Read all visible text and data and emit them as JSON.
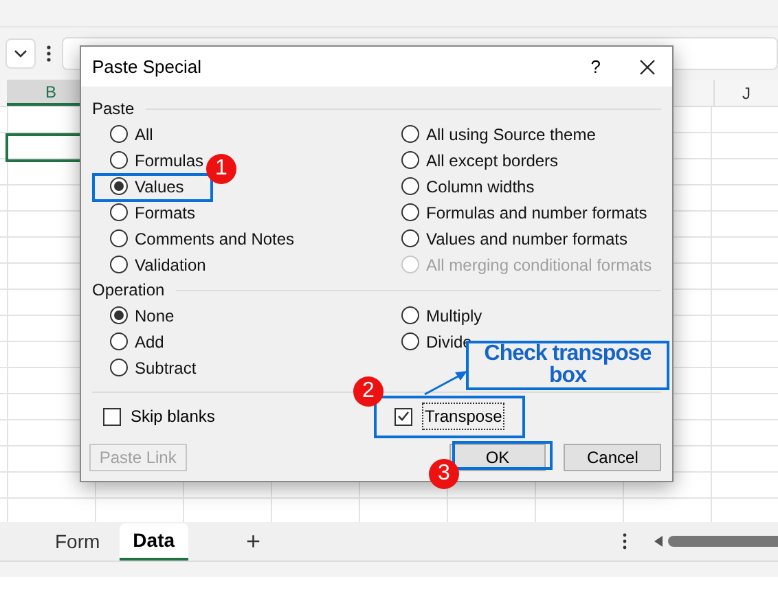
{
  "columns": [
    "B",
    "J"
  ],
  "dialog": {
    "title": "Paste Special",
    "help": "?",
    "paste": {
      "label": "Paste",
      "left_options": [
        {
          "label": "All",
          "selected": false,
          "disabled": false
        },
        {
          "label": "Formulas",
          "selected": false,
          "disabled": false
        },
        {
          "label": "Values",
          "selected": true,
          "disabled": false
        },
        {
          "label": "Formats",
          "selected": false,
          "disabled": false
        },
        {
          "label": "Comments and Notes",
          "selected": false,
          "disabled": false
        },
        {
          "label": "Validation",
          "selected": false,
          "disabled": false
        }
      ],
      "right_options": [
        {
          "label": "All using Source theme",
          "selected": false,
          "disabled": false
        },
        {
          "label": "All except borders",
          "selected": false,
          "disabled": false
        },
        {
          "label": "Column widths",
          "selected": false,
          "disabled": false
        },
        {
          "label": "Formulas and number formats",
          "selected": false,
          "disabled": false
        },
        {
          "label": "Values and number formats",
          "selected": false,
          "disabled": false
        },
        {
          "label": "All merging conditional formats",
          "selected": false,
          "disabled": true
        }
      ]
    },
    "operation": {
      "label": "Operation",
      "left_options": [
        {
          "label": "None",
          "selected": true
        },
        {
          "label": "Add",
          "selected": false
        },
        {
          "label": "Subtract",
          "selected": false
        }
      ],
      "right_options": [
        {
          "label": "Multiply",
          "selected": false
        },
        {
          "label": "Divide",
          "selected": false
        }
      ]
    },
    "checkboxes": [
      {
        "label": "Skip blanks",
        "checked": false
      },
      {
        "label": "Transpose",
        "checked": true
      }
    ],
    "buttons": [
      {
        "label": "Paste Link",
        "disabled": true
      },
      {
        "label": "OK",
        "disabled": false
      },
      {
        "label": "Cancel",
        "disabled": false
      }
    ]
  },
  "annotations": {
    "markers": [
      "1",
      "2",
      "3"
    ],
    "callout": "Check transpose box"
  },
  "sheet_tabs": [
    {
      "label": "Form",
      "selected": false
    },
    {
      "label": "Data",
      "selected": true
    }
  ],
  "add_sheet": "+"
}
